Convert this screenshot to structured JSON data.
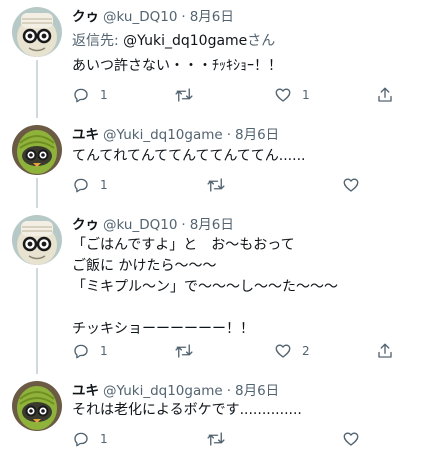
{
  "tweets": [
    {
      "name": "クゥ",
      "handle": "@ku_DQ10",
      "date": "8月6日",
      "reply_prefix": "返信先: ",
      "reply_handle": "@Yuki_dq10game",
      "reply_suffix": "さん",
      "text": "あいつ許さない・・・ﾁｯｷｼｮｰ！！",
      "reply_count": "1",
      "retweet_count": "",
      "like_count": "1"
    },
    {
      "name": "ユキ",
      "handle": "@Yuki_dq10game",
      "date": "8月6日",
      "text": "てんてれてんててんててんててん......",
      "reply_count": "1",
      "retweet_count": "",
      "like_count": ""
    },
    {
      "name": "クゥ",
      "handle": "@ku_DQ10",
      "date": "8月6日",
      "text": "「ごはんですよ」と　お～もおって\nご飯に かけたら～～～\n「ミキプル～ン」で～～～し～～た～～～\n\nチッキショーーーーーー！！",
      "reply_count": "1",
      "retweet_count": "",
      "like_count": "2"
    },
    {
      "name": "ユキ",
      "handle": "@Yuki_dq10game",
      "date": "8月6日",
      "text": "それは老化によるボケです..............",
      "reply_count": "1",
      "retweet_count": "",
      "like_count": ""
    }
  ],
  "icons": {
    "reply": "reply-icon",
    "retweet": "retweet-icon",
    "like": "heart-icon",
    "share": "share-icon"
  },
  "colors": {
    "link": "#1d9bf0",
    "secondary_text": "#536471",
    "thread_line": "#cfd9de"
  }
}
